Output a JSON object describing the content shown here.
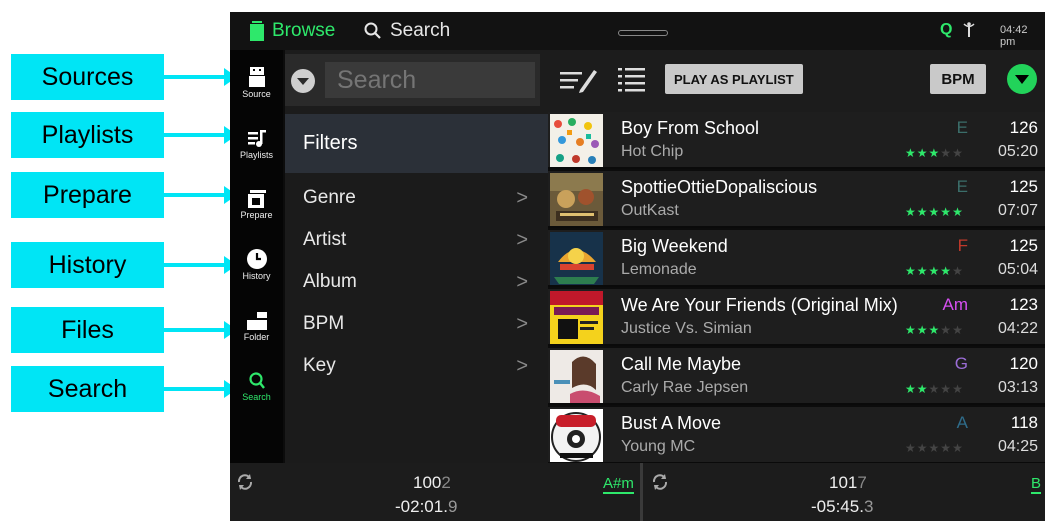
{
  "callouts": [
    "Sources",
    "Playlists",
    "Prepare",
    "History",
    "Files",
    "Search"
  ],
  "topbar": {
    "browse_label": "Browse",
    "search_label": "Search",
    "q_label": "Q",
    "time": "04:42 pm"
  },
  "sidebar": {
    "items": [
      {
        "label": "Source",
        "icon": "usb-drive-icon"
      },
      {
        "label": "Playlists",
        "icon": "playlist-icon"
      },
      {
        "label": "Prepare",
        "icon": "prepare-icon"
      },
      {
        "label": "History",
        "icon": "clock-icon"
      },
      {
        "label": "Folder",
        "icon": "folder-icon"
      },
      {
        "label": "Search",
        "icon": "search-icon"
      }
    ]
  },
  "toolbar": {
    "search_placeholder": "Search",
    "play_as_playlist": "PLAY AS PLAYLIST",
    "sort_label": "BPM"
  },
  "filters": {
    "header": "Filters",
    "items": [
      "Genre",
      "Artist",
      "Album",
      "BPM",
      "Key"
    ]
  },
  "tracks": [
    {
      "title": "Boy From School",
      "artist": "Hot Chip",
      "key": "E",
      "key_color": "#3b6e6a",
      "bpm": "126",
      "time": "05:20",
      "rating": 3
    },
    {
      "title": "SpottieOttieDopaliscious",
      "artist": "OutKast",
      "key": "E",
      "key_color": "#3b6e6a",
      "bpm": "125",
      "time": "07:07",
      "rating": 5
    },
    {
      "title": "Big Weekend",
      "artist": "Lemonade",
      "key": "F",
      "key_color": "#c0392b",
      "bpm": "125",
      "time": "05:04",
      "rating": 4
    },
    {
      "title": "We Are Your Friends (Original Mix)",
      "artist": "Justice Vs. Simian",
      "key": "Am",
      "key_color": "#d64ff0",
      "bpm": "123",
      "time": "04:22",
      "rating": 3
    },
    {
      "title": "Call Me Maybe",
      "artist": "Carly Rae Jepsen",
      "key": "G",
      "key_color": "#9b6dd6",
      "bpm": "120",
      "time": "03:13",
      "rating": 2
    },
    {
      "title": "Bust A Move",
      "artist": "Young MC",
      "key": "A",
      "key_color": "#2f6c8a",
      "bpm": "118",
      "time": "04:25",
      "rating": 0
    }
  ],
  "decks": [
    {
      "bpm_main": "100",
      "bpm_dec": "2",
      "time_main": "-02:01.",
      "time_dec": "9",
      "key": "A#m"
    },
    {
      "bpm_main": "101",
      "bpm_dec": "7",
      "time_main": "-05:45.",
      "time_dec": "3",
      "key": "B"
    }
  ]
}
